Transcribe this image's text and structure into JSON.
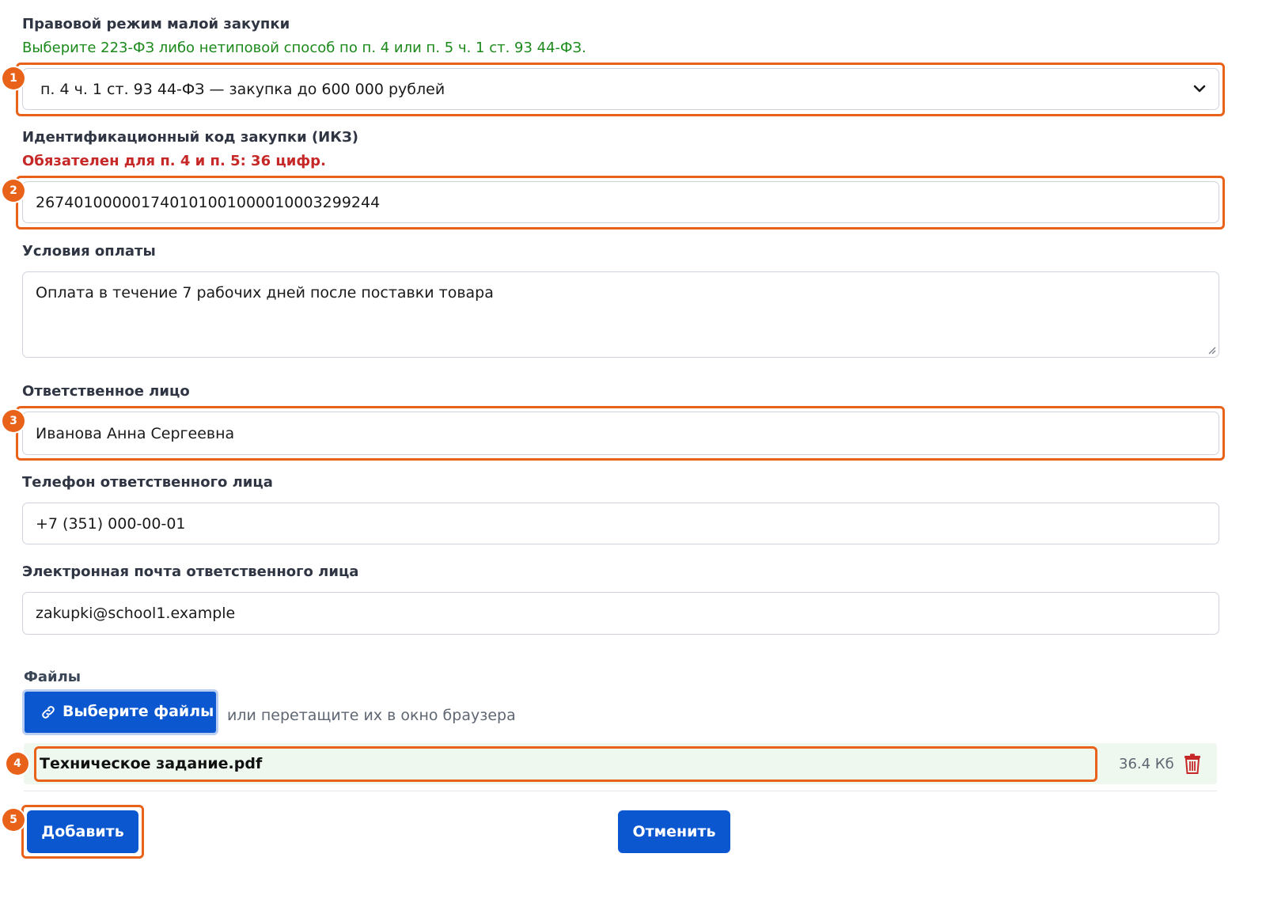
{
  "legal_regime": {
    "label": "Правовой режим малой закупки",
    "hint": "Выберите 223-ФЗ либо нетиповой способ по п. 4 или п. 5 ч. 1 ст. 93 44-ФЗ.",
    "selected": "п. 4 ч. 1 ст. 93 44-ФЗ — закупка до 600 000 рублей"
  },
  "ikz": {
    "label": "Идентификационный код закупки (ИКЗ)",
    "hint": "Обязателен для п. 4 и п. 5: 36 цифр.",
    "value": "267401000001740101001000010003299244"
  },
  "payment": {
    "label": "Условия оплаты",
    "value": "Оплата в течение 7 рабочих дней после поставки товара"
  },
  "responsible": {
    "label": "Ответственное лицо",
    "value": "Иванова Анна Сергеевна"
  },
  "phone": {
    "label": "Телефон ответственного лица",
    "value": "+7 (351) 000-00-01"
  },
  "email": {
    "label": "Электронная почта ответственного лица",
    "value": "zakupki@school1.example"
  },
  "files": {
    "label": "Файлы",
    "choose_button": "Выберите файлы",
    "drop_hint": "или перетащите их в окно браузера",
    "items": [
      {
        "name": "Техническое задание.pdf",
        "size": "36.4 Кб"
      }
    ]
  },
  "actions": {
    "add": "Добавить",
    "cancel": "Отменить"
  },
  "markers": [
    "1",
    "2",
    "3",
    "4",
    "5"
  ],
  "colors": {
    "accent": "#0b57d0",
    "highlight": "#e8621a",
    "hint_green": "#1b8a1b",
    "hint_red": "#c62828",
    "delete": "#c62828"
  },
  "icons": {
    "select_arrow": "chevron-down-icon",
    "choose_files": "link-icon",
    "delete_file": "trash-icon"
  }
}
